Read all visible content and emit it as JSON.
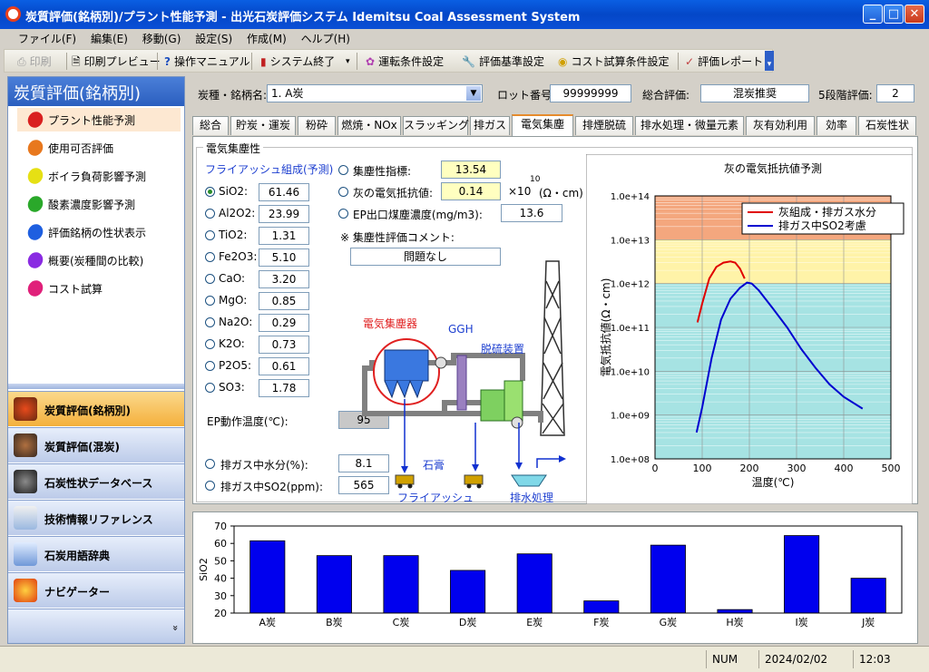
{
  "window": {
    "title": "炭質評価(銘柄別)/プラント性能予測 - 出光石炭評価システム Idemitsu Coal Assessment System",
    "min": "_",
    "max": "□",
    "close": "✕"
  },
  "menu": [
    "ファイル(F)",
    "編集(E)",
    "移動(G)",
    "設定(S)",
    "作成(M)",
    "ヘルプ(H)"
  ],
  "toolbar": {
    "print": "印刷",
    "preview": "印刷プレビュー",
    "manual": "操作マニュアル",
    "exit": "システム終了",
    "run_cond": "運転条件設定",
    "eval_std": "評価基準設定",
    "cost_cond": "コスト試算条件設定",
    "report": "評価レポート"
  },
  "sidebar": {
    "title": "炭質評価(銘柄別)",
    "items": [
      {
        "label": "プラント性能予測",
        "color": "#d92020"
      },
      {
        "label": "使用可否評価",
        "color": "#e8781e"
      },
      {
        "label": "ボイラ負荷影響予測",
        "color": "#e6e014"
      },
      {
        "label": "酸素濃度影響予測",
        "color": "#2aa82a"
      },
      {
        "label": "評価銘柄の性状表示",
        "color": "#1e5fe0"
      },
      {
        "label": "概要(炭種間の比較)",
        "color": "#8a2be2"
      },
      {
        "label": "コスト試算",
        "color": "#e0207a"
      }
    ],
    "nav": [
      "炭質評価(銘柄別)",
      "炭質評価(混炭)",
      "石炭性状データベース",
      "技術情報リファレンス",
      "石炭用語辞典",
      "ナビゲーター"
    ],
    "more": "»"
  },
  "header": {
    "coal_label": "炭種・銘柄名:",
    "coal_value": "1. A炭",
    "lot_label": "ロット番号:",
    "lot_value": "99999999",
    "total_label": "総合評価:",
    "total_value": "混炭推奨",
    "grade_label": "5段階評価:",
    "grade_value": "2"
  },
  "tabs": [
    "総合",
    "貯炭・運炭",
    "粉砕",
    "燃焼・NOx",
    "スラッギング",
    "排ガス",
    "電気集塵",
    "排煙脱硫",
    "排水処理・微量元素",
    "灰有効利用",
    "効率",
    "石炭性状"
  ],
  "selected_tab": "電気集塵",
  "esp": {
    "group": "電気集塵性",
    "fly_ash_label": "フライアッシュ組成(予測)",
    "components": [
      {
        "name": "SiO2:",
        "value": "61.46"
      },
      {
        "name": "Al2O2:",
        "value": "23.99"
      },
      {
        "name": "TiO2:",
        "value": "1.31"
      },
      {
        "name": "Fe2O3:",
        "value": "5.10"
      },
      {
        "name": "CaO:",
        "value": "3.20"
      },
      {
        "name": "MgO:",
        "value": "0.85"
      },
      {
        "name": "Na2O:",
        "value": "0.29"
      },
      {
        "name": "K2O:",
        "value": "0.73"
      },
      {
        "name": "P2O5:",
        "value": "0.61"
      },
      {
        "name": "SO3:",
        "value": "1.78"
      }
    ],
    "ep_temp_label": "EP動作温度(℃):",
    "ep_temp_value": "95",
    "moisture_label": "排ガス中水分(%):",
    "moisture_value": "8.1",
    "so2_label": "排ガス中SO2(ppm):",
    "so2_value": "565",
    "index_label": "集塵性指標:",
    "index_value": "13.54",
    "resist_label": "灰の電気抵抗値:",
    "resist_value": "0.14",
    "resist_unit": "×10",
    "resist_exp": "10",
    "resist_unit2": "(Ω・cm)",
    "ep_conc_label": "EP出口煤塵濃度(mg/m3):",
    "ep_conc_value": "13.6",
    "comment_label": "※ 集塵性評価コメント:",
    "comment_value": "問題なし",
    "diagram": {
      "esp": "電気集塵器",
      "ggh": "GGH",
      "fgd": "脱硫装置",
      "gypsum": "石膏",
      "fly_ash": "フライアッシュ",
      "wastewater": "排水処理"
    }
  },
  "chart_data": [
    {
      "type": "line",
      "title": "灰の電気抵抗値予測",
      "xlabel": "温度(℃)",
      "ylabel": "電気抵抗値(Ω・cm)",
      "yscale": "log",
      "xlim": [
        0,
        500
      ],
      "ylim": [
        100000000.0,
        100000000000000.0
      ],
      "xticks": [
        "0",
        "100",
        "200",
        "300",
        "400",
        "500"
      ],
      "yticks": [
        "1.0e+08",
        "1.0e+09",
        "1.0e+10",
        "1.0e+11",
        "1.0e+12",
        "1.0e+13",
        "1.0e+14"
      ],
      "bands": [
        {
          "from": 10000000000000.0,
          "to": 100000000000000.0,
          "color": "#f4a77e"
        },
        {
          "from": 1000000000000.0,
          "to": 10000000000000.0,
          "color": "#fff3a8"
        },
        {
          "from": 100000000.0,
          "to": 1000000000000.0,
          "color": "#a6e3e3"
        }
      ],
      "legend_position": "top-right",
      "series": [
        {
          "name": "灰組成・排ガス水分",
          "color": "#e00000",
          "x": [
            90,
            100,
            115,
            130,
            145,
            160,
            170,
            180,
            190
          ],
          "y": [
            130000000000.0,
            350000000000.0,
            1300000000000.0,
            2400000000000.0,
            3000000000000.0,
            3200000000000.0,
            3000000000000.0,
            2200000000000.0,
            1300000000000.0
          ]
        },
        {
          "name": "排ガス中SO2考慮",
          "color": "#0000d0",
          "x": [
            88,
            100,
            120,
            140,
            160,
            180,
            195,
            205,
            220,
            250,
            280,
            310,
            340,
            370,
            400,
            440
          ],
          "y": [
            400000000.0,
            1500000000.0,
            20000000000.0,
            150000000000.0,
            450000000000.0,
            800000000000.0,
            1050000000000.0,
            1000000000000.0,
            700000000000.0,
            270000000000.0,
            100000000000.0,
            32000000000.0,
            12000000000.0,
            5000000000.0,
            2600000000.0,
            1400000000.0
          ]
        }
      ]
    },
    {
      "type": "bar",
      "ylabel": "SiO2",
      "ylim": [
        20,
        70
      ],
      "yticks": [
        "20",
        "30",
        "40",
        "50",
        "60",
        "70"
      ],
      "categories": [
        "A炭",
        "B炭",
        "C炭",
        "D炭",
        "E炭",
        "F炭",
        "G炭",
        "H炭",
        "I炭",
        "J炭"
      ],
      "values": [
        61.5,
        53,
        53,
        44.5,
        54,
        27,
        59,
        22,
        64.5,
        40
      ],
      "color": "#0000ee"
    }
  ],
  "status": {
    "mode": "NUM",
    "date": "2024/02/02",
    "time": "12:03"
  }
}
